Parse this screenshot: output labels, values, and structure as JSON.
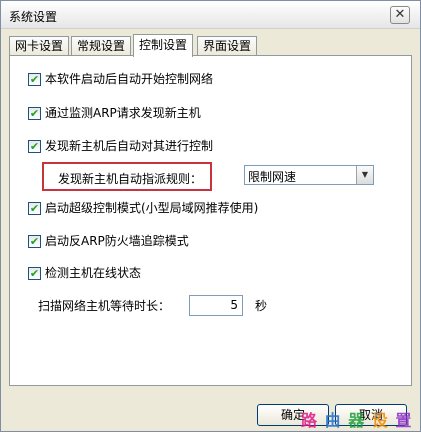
{
  "window": {
    "title": "系统设置",
    "close_glyph": "✕"
  },
  "tabs": [
    {
      "label": "网卡设置",
      "active": false
    },
    {
      "label": "常规设置",
      "active": false
    },
    {
      "label": "控制设置",
      "active": true
    },
    {
      "label": "界面设置",
      "active": false
    }
  ],
  "options": [
    {
      "label": "本软件启动后自动开始控制网络",
      "checked": true
    },
    {
      "label": "通过监测ARP请求发现新主机",
      "checked": true
    },
    {
      "label": "发现新主机后自动对其进行控制",
      "checked": true
    },
    {
      "label": "启动超级控制模式(小型局域网推荐使用)",
      "checked": true
    },
    {
      "label": "启动反ARP防火墙追踪模式",
      "checked": true
    },
    {
      "label": "检测主机在线状态",
      "checked": true
    }
  ],
  "assign_rule": {
    "label": "发现新主机自动指派规则：",
    "selected": "限制网速",
    "arrow_glyph": "▼"
  },
  "scan_wait": {
    "label": "扫描网络主机等待时长：",
    "value": "5",
    "unit": "秒"
  },
  "buttons": {
    "ok": "确定",
    "cancel": "取消"
  },
  "watermark": {
    "chars": [
      "路",
      "由",
      "器",
      "设",
      "置"
    ]
  },
  "icons": {
    "check": "✔"
  }
}
